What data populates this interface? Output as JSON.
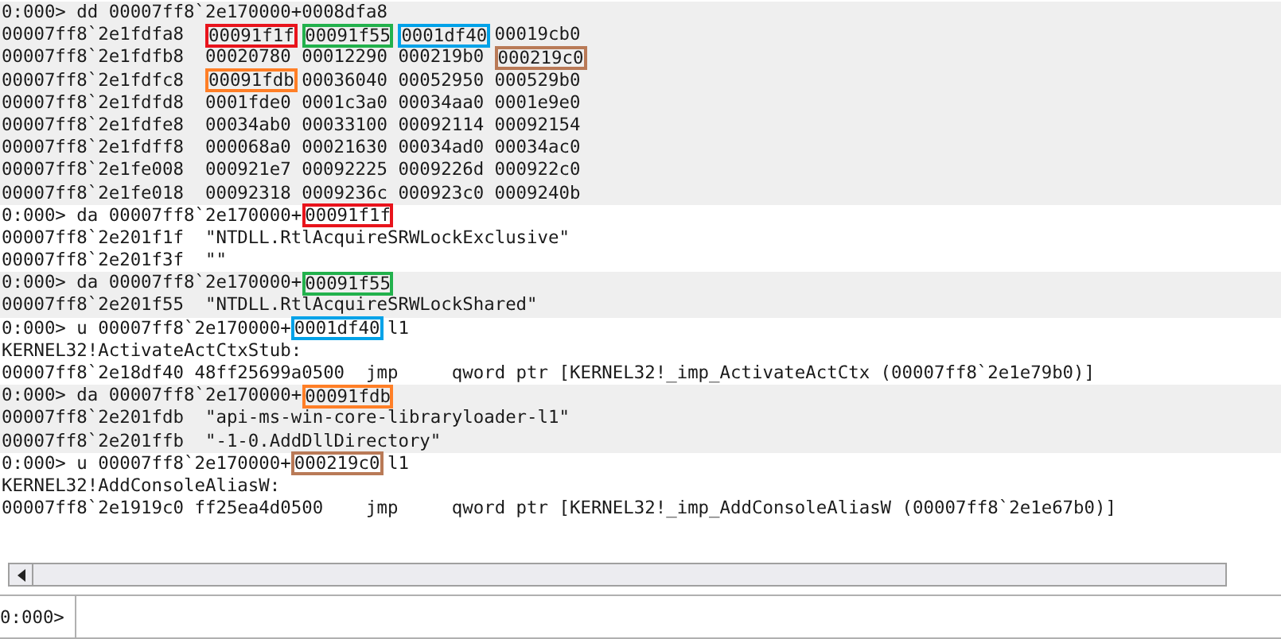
{
  "output": [
    {
      "shaded": true,
      "command": [
        {
          "text": "0:000> dd 00007ff8`2e170000+0008dfa8"
        }
      ],
      "dump_rows": [
        {
          "address": "00007ff8`2e1fdfa8",
          "values": [
            {
              "text": "00091f1f",
              "color": "#e8141c"
            },
            {
              "text": "00091f55",
              "color": "#22b14c"
            },
            {
              "text": "0001df40",
              "color": "#00a2e8"
            },
            {
              "text": "00019cb0"
            }
          ]
        },
        {
          "address": "00007ff8`2e1fdfb8",
          "values": [
            {
              "text": "00020780"
            },
            {
              "text": "00012290"
            },
            {
              "text": "000219b0"
            },
            {
              "text": "000219c0",
              "color": "#b97a57"
            }
          ]
        },
        {
          "address": "00007ff8`2e1fdfc8",
          "values": [
            {
              "text": "00091fdb",
              "color": "#ff7f27"
            },
            {
              "text": "00036040"
            },
            {
              "text": "00052950"
            },
            {
              "text": "000529b0"
            }
          ]
        },
        {
          "address": "00007ff8`2e1fdfd8",
          "values": [
            {
              "text": "0001fde0"
            },
            {
              "text": "0001c3a0"
            },
            {
              "text": "00034aa0"
            },
            {
              "text": "0001e9e0"
            }
          ]
        },
        {
          "address": "00007ff8`2e1fdfe8",
          "values": [
            {
              "text": "00034ab0"
            },
            {
              "text": "00033100"
            },
            {
              "text": "00092114"
            },
            {
              "text": "00092154"
            }
          ]
        },
        {
          "address": "00007ff8`2e1fdff8",
          "values": [
            {
              "text": "000068a0"
            },
            {
              "text": "00021630"
            },
            {
              "text": "00034ad0"
            },
            {
              "text": "00034ac0"
            }
          ]
        },
        {
          "address": "00007ff8`2e1fe008",
          "values": [
            {
              "text": "000921e7"
            },
            {
              "text": "00092225"
            },
            {
              "text": "0009226d"
            },
            {
              "text": "000922c0"
            }
          ]
        },
        {
          "address": "00007ff8`2e1fe018",
          "values": [
            {
              "text": "00092318"
            },
            {
              "text": "0009236c"
            },
            {
              "text": "000923c0"
            },
            {
              "text": "0009240b"
            }
          ]
        }
      ]
    },
    {
      "shaded": false,
      "command": [
        {
          "text": "0:000> da 00007ff8`2e170000+"
        },
        {
          "text": "00091f1f",
          "color": "#e8141c"
        }
      ],
      "lines": [
        "00007ff8`2e201f1f  \"NTDLL.RtlAcquireSRWLockExclusive\"",
        "00007ff8`2e201f3f  \"\""
      ]
    },
    {
      "shaded": true,
      "command": [
        {
          "text": "0:000> da 00007ff8`2e170000+"
        },
        {
          "text": "00091f55",
          "color": "#22b14c"
        }
      ],
      "lines": [
        "00007ff8`2e201f55  \"NTDLL.RtlAcquireSRWLockShared\""
      ]
    },
    {
      "shaded": false,
      "command": [
        {
          "text": "0:000> u 00007ff8`2e170000+"
        },
        {
          "text": "0001df40",
          "color": "#00a2e8"
        },
        {
          "text": " l1"
        }
      ],
      "lines": [
        "KERNEL32!ActivateActCtxStub:",
        "00007ff8`2e18df40 48ff25699a0500  jmp     qword ptr [KERNEL32!_imp_ActivateActCtx (00007ff8`2e1e79b0)]"
      ]
    },
    {
      "shaded": true,
      "command": [
        {
          "text": "0:000> da 00007ff8`2e170000+"
        },
        {
          "text": "00091fdb",
          "color": "#ff7f27"
        }
      ],
      "lines": [
        "00007ff8`2e201fdb  \"api-ms-win-core-libraryloader-l1\"",
        "00007ff8`2e201ffb  \"-1-0.AddDllDirectory\""
      ]
    },
    {
      "shaded": false,
      "command": [
        {
          "text": "0:000> u 00007ff8`2e170000+"
        },
        {
          "text": "000219c0",
          "color": "#b97a57"
        },
        {
          "text": " l1"
        }
      ],
      "lines": [
        "KERNEL32!AddConsoleAliasW:",
        "00007ff8`2e1919c0 ff25ea4d0500    jmp     qword ptr [KERNEL32!_imp_AddConsoleAliasW (00007ff8`2e1e67b0)]"
      ]
    }
  ],
  "prompt": "0:000>"
}
